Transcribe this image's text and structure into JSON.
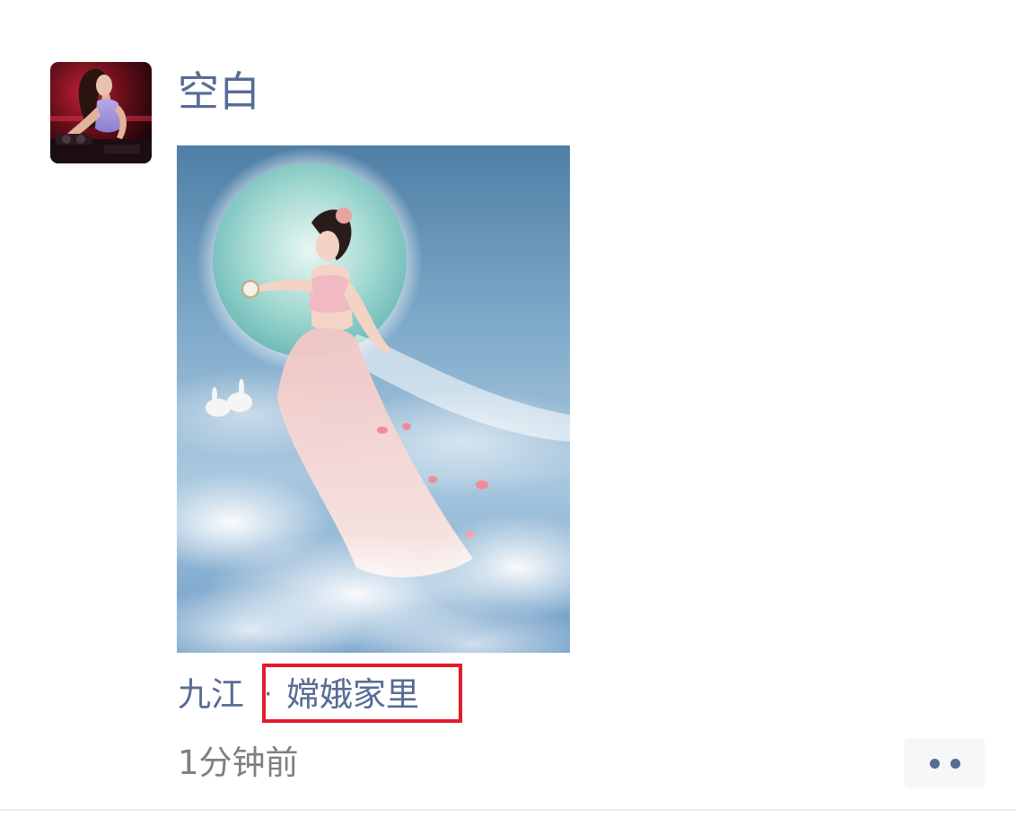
{
  "post": {
    "author": "空白",
    "avatar_icon": "user-avatar-photo",
    "image_icon": "moon-goddess-photo",
    "location": {
      "city": "九江",
      "separator": "·",
      "place": "嫦娥家里"
    },
    "timestamp": "1分钟前",
    "more_icon": "more-dots-icon"
  },
  "colors": {
    "link": "#576b95",
    "timestamp": "#7f7f7f",
    "highlight": "#e31c2b",
    "more_bg": "#f7f7f7"
  }
}
